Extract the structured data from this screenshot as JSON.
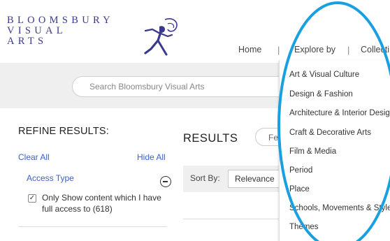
{
  "brand": {
    "logo_lines": [
      "BLOOMSBURY",
      "VISUAL",
      "ARTS"
    ],
    "color": "#3a3a8c"
  },
  "topnav": {
    "home": "Home",
    "explore_by": "Explore by",
    "collections": "Collecti"
  },
  "search": {
    "placeholder": "Search Bloomsbury Visual Arts"
  },
  "sidebar": {
    "title": "REFINE RESULTS:",
    "clear_all": "Clear All",
    "hide_all": "Hide All",
    "facet_title": "Access Type",
    "checkbox_checked": true,
    "checkbox_label": "Only Show content which I have full access to (618)",
    "icons": [
      "minus-circle-icon",
      "checkmark-icon"
    ]
  },
  "results": {
    "title": "RESULTS",
    "tab_label": "Fea",
    "sort_label": "Sort By:",
    "sort_value": "Relevance"
  },
  "dropdown": {
    "items": [
      "Art & Visual Culture",
      "Design & Fashion",
      "Architecture & Interior Desig",
      "Craft & Decorative Arts",
      "Film & Media",
      "Period",
      "Place",
      "Schools, Movements & Styles",
      "Themes"
    ]
  },
  "colors": {
    "link": "#3b5fcf",
    "highlight": "#1a9fe0",
    "band": "#efefef"
  }
}
